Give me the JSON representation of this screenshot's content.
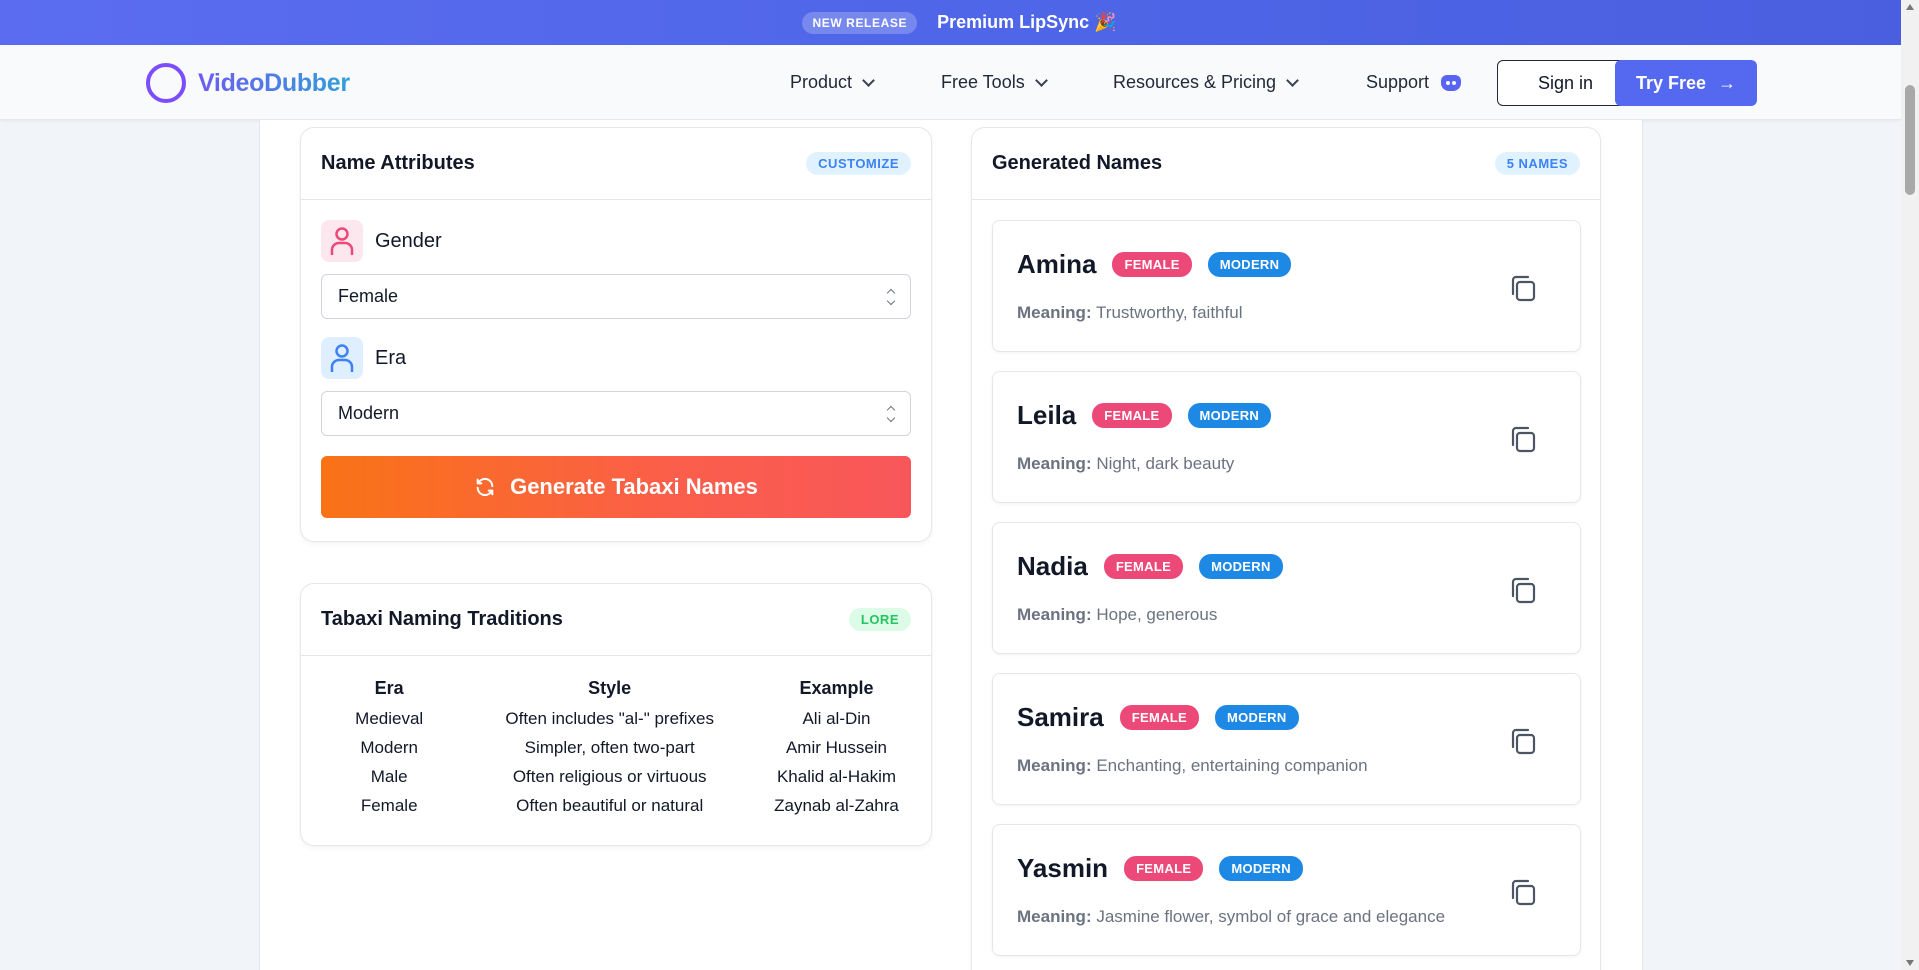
{
  "banner": {
    "badge": "NEW RELEASE",
    "promo": "Premium LipSync 🎉"
  },
  "nav": {
    "brand": "VideoDubber",
    "items": [
      {
        "label": "Product"
      },
      {
        "label": "Free Tools"
      },
      {
        "label": "Resources & Pricing"
      },
      {
        "label": "Support"
      }
    ],
    "signin_label": "Sign in",
    "try_label": "Try Free"
  },
  "attributes": {
    "title": "Name Attributes",
    "badge": "CUSTOMIZE",
    "gender_label": "Gender",
    "gender_value": "Female",
    "era_label": "Era",
    "era_value": "Modern",
    "generate_label": "Generate Tabaxi Names",
    "colors": {
      "gender_icon": "#ec4878",
      "era_icon": "#3b82f6"
    }
  },
  "traditions": {
    "title": "Tabaxi Naming Traditions",
    "badge": "LORE",
    "headers": [
      "Era",
      "Style",
      "Example"
    ],
    "rows": [
      [
        "Medieval",
        "Often includes \"al-\" prefixes",
        "Ali al-Din"
      ],
      [
        "Modern",
        "Simpler, often two-part",
        "Amir Hussein"
      ],
      [
        "Male",
        "Often religious or virtuous",
        "Khalid al-Hakim"
      ],
      [
        "Female",
        "Often beautiful or natural",
        "Zaynab al-Zahra"
      ]
    ]
  },
  "generated": {
    "title": "Generated Names",
    "badge": "5 NAMES",
    "meaning_label": "Meaning:",
    "names": [
      {
        "name": "Amina",
        "gender": "FEMALE",
        "era": "MODERN",
        "meaning": "Trustworthy, faithful"
      },
      {
        "name": "Leila",
        "gender": "FEMALE",
        "era": "MODERN",
        "meaning": "Night, dark beauty"
      },
      {
        "name": "Nadia",
        "gender": "FEMALE",
        "era": "MODERN",
        "meaning": "Hope, generous"
      },
      {
        "name": "Samira",
        "gender": "FEMALE",
        "era": "MODERN",
        "meaning": "Enchanting, entertaining companion"
      },
      {
        "name": "Yasmin",
        "gender": "FEMALE",
        "era": "MODERN",
        "meaning": "Jasmine flower, symbol of grace and elegance"
      }
    ]
  }
}
